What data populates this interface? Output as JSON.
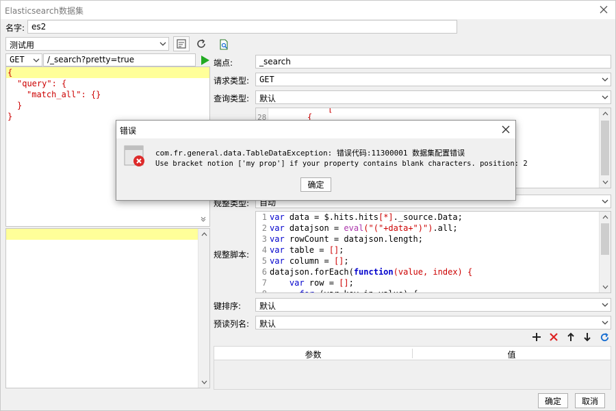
{
  "window": {
    "title": "Elasticsearch数据集"
  },
  "name": {
    "label": "名字:",
    "value": "es2"
  },
  "left": {
    "connection": "测试用",
    "method": "GET",
    "url": "/_search?pretty=true",
    "query_lines": [
      {
        "text": "{",
        "indent": 0
      },
      {
        "text": "\"query\": {",
        "indent": 1
      },
      {
        "text": "\"match_all\": {}",
        "indent": 2
      },
      {
        "text": "}",
        "indent": 1
      },
      {
        "text": "}",
        "indent": 0
      }
    ]
  },
  "right": {
    "endpoint": {
      "label": "端点:",
      "value": "_search"
    },
    "request_type": {
      "label": "请求类型:",
      "value": "GET"
    },
    "query_type": {
      "label": "查询类型:",
      "value": "默认"
    },
    "top_code": {
      "ln1": "28",
      "line1": "{",
      "partial": "["
    },
    "rule_type": {
      "label": "规整类型:",
      "value": "自动"
    },
    "rule_script": {
      "label": "规整脚本:",
      "lines": [
        {
          "n": "1",
          "kw": "var",
          "rest": " data = $.hits.hits",
          "red": "[*]",
          "tail": "._source.Data;"
        },
        {
          "n": "2",
          "kw": "var",
          "rest": " datajson = ",
          "ev": "eval",
          "red": "(\"(\"+data+\")\")",
          "tail": ".all;"
        },
        {
          "n": "3",
          "kw": "var",
          "rest": " rowCount = datajson.length;",
          "red": "",
          "tail": ""
        },
        {
          "n": "4",
          "kw": "var",
          "rest": " table = ",
          "red": "[]",
          "tail": ";"
        },
        {
          "n": "5",
          "kw": "var",
          "rest": " column = ",
          "red": "[]",
          "tail": ";"
        },
        {
          "n": "6",
          "kw": "",
          "rest": "datajson.forEach(",
          "kw2": "function",
          "red": "(value, index) {",
          "tail": ""
        },
        {
          "n": "7",
          "kw": "    var",
          "rest": " row = ",
          "red": "[]",
          "tail": ";"
        },
        {
          "n": "8",
          "kw": "      for",
          "rest": " (var key in value) {",
          "red": "",
          "tail": ""
        }
      ]
    },
    "key_sort": {
      "label": "键排序:",
      "value": "默认"
    },
    "preview_cols": {
      "label": "预读列名:",
      "value": "默认"
    },
    "params_table": {
      "col1": "参数",
      "col2": "值"
    }
  },
  "footer": {
    "ok": "确定",
    "cancel": "取消"
  },
  "error_dialog": {
    "title": "错误",
    "line1": "com.fr.general.data.TableDataException: 错误代码:11300001 数据集配置错误",
    "line2": "Use bracket notion ['my prop'] if your property contains blank characters. position: 2",
    "ok": "确定"
  },
  "colors": {
    "highlight": "#ffff99",
    "keyword": "#0000cc",
    "string": "#cc0000",
    "run_green": "#22aa22",
    "delete_red": "#dd2222",
    "refresh_blue": "#1a6fd1"
  }
}
